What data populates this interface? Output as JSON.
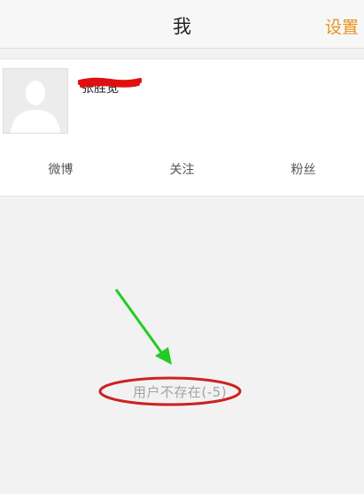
{
  "navbar": {
    "title": "我",
    "settings_label": "设置"
  },
  "profile": {
    "username": "张胜宽"
  },
  "tabs": [
    {
      "label": "微博"
    },
    {
      "label": "关注"
    },
    {
      "label": "粉丝"
    }
  ],
  "message": {
    "error": "用户不存在(-5)"
  },
  "colors": {
    "accent": "#e8921a",
    "annotation_arrow": "#22cc22",
    "annotation_circle": "#cc2222",
    "redaction": "#e01010"
  }
}
